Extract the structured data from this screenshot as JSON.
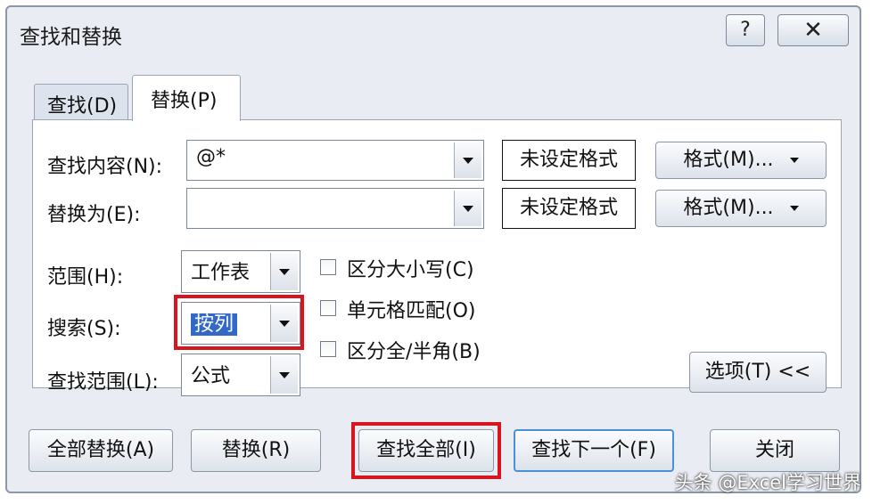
{
  "dialog": {
    "title": "查找和替换",
    "help_symbol": "?",
    "close_symbol": "✕"
  },
  "tabs": [
    {
      "label": "查找(D)",
      "active": false
    },
    {
      "label": "替换(P)",
      "active": true
    }
  ],
  "replace_tab": {
    "find_label": "查找内容(N):",
    "find_value": "@*",
    "replace_label": "替换为(E):",
    "replace_value": "",
    "format_preview": "未设定格式",
    "format_button": "格式(M)...",
    "scope_label": "范围(H):",
    "scope_value": "工作表",
    "search_label": "搜索(S):",
    "search_value": "按列",
    "lookin_label": "查找范围(L):",
    "lookin_value": "公式",
    "options": [
      {
        "label": "区分大小写(C)",
        "checked": false
      },
      {
        "label": "单元格匹配(O)",
        "checked": false
      },
      {
        "label": "区分全/半角(B)",
        "checked": false
      }
    ],
    "options_button": "选项(T) <<"
  },
  "buttons": {
    "replace_all": "全部替换(A)",
    "replace": "替换(R)",
    "find_all": "查找全部(I)",
    "find_next": "查找下一个(F)",
    "close": "关闭"
  },
  "watermark": "头条 @Excel学习世界",
  "colors": {
    "highlight_box": "#d8141e",
    "selection": "#3268c8",
    "dialog_bg": "#e9edf3"
  }
}
